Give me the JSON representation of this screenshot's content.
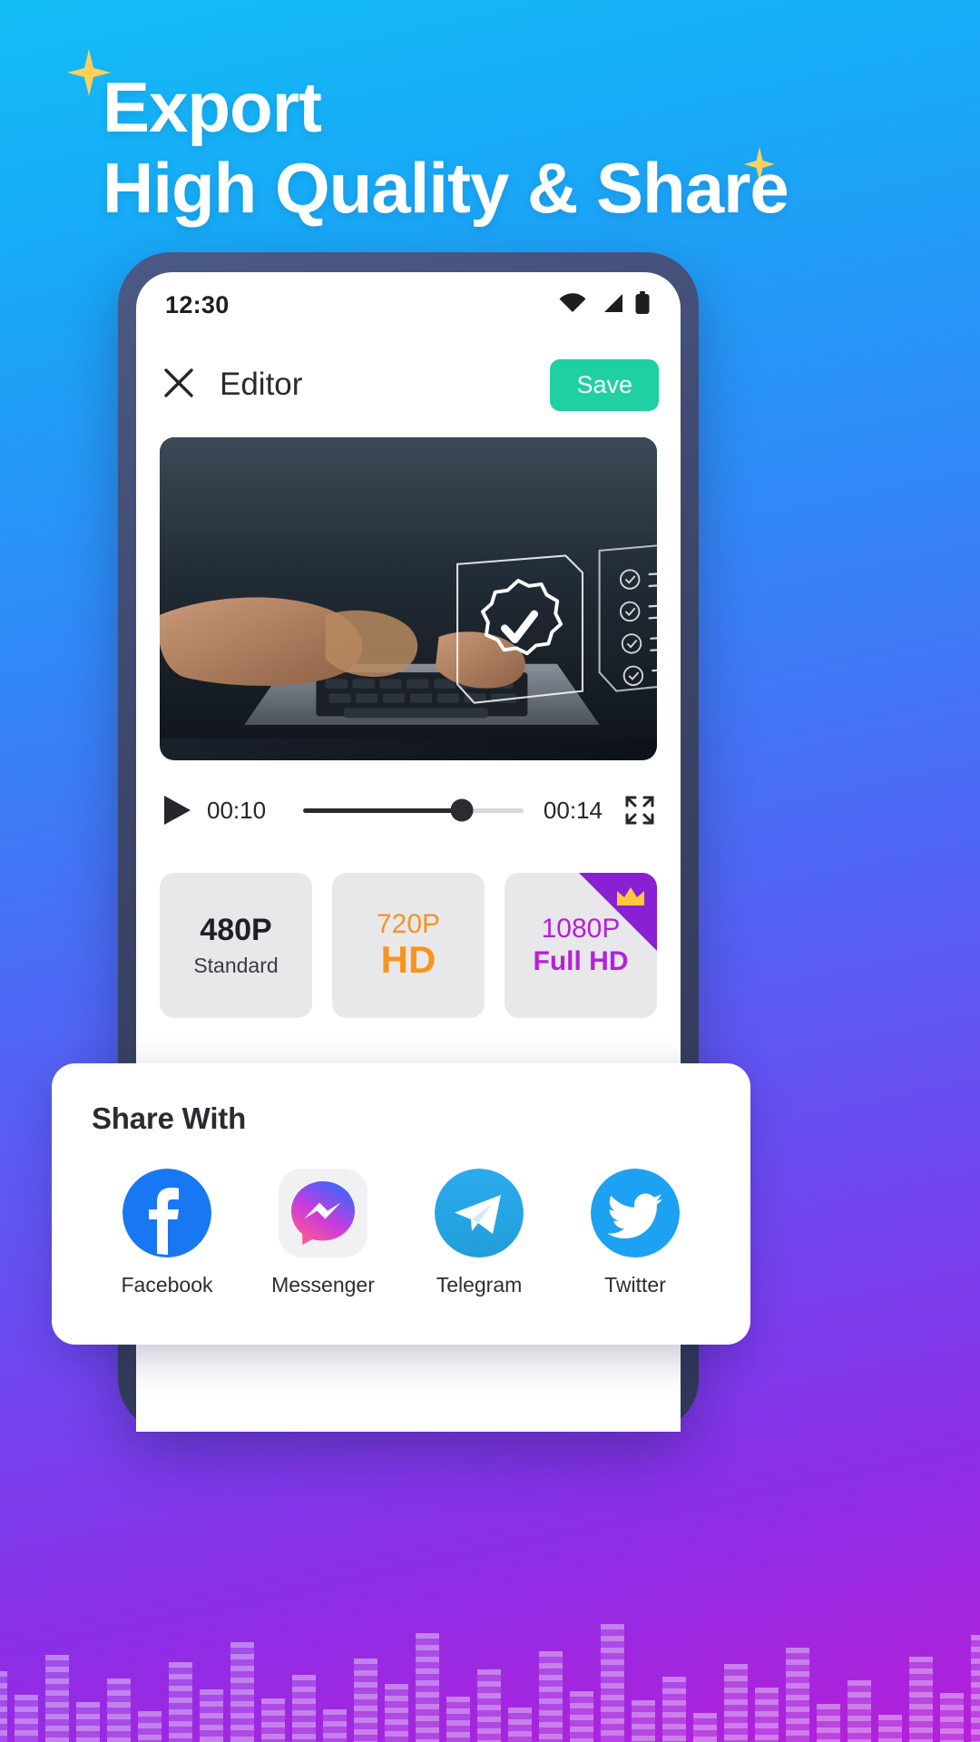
{
  "promo": {
    "headline_line1": "Export",
    "headline_line2": "High Quality & Share",
    "background_gradient": [
      "#13bdf7",
      "#4a6cf5",
      "#b51fd8"
    ],
    "sparkle_color": "#ffd257"
  },
  "phone": {
    "status_bar": {
      "time": "12:30",
      "icons": [
        "wifi-icon",
        "cellular-signal-icon",
        "battery-icon"
      ]
    },
    "editor_header": {
      "close_icon": "close-icon",
      "title": "Editor",
      "save_label": "Save",
      "save_color": "#1fd0a3"
    },
    "player": {
      "play_icon": "play-icon",
      "current_time": "00:10",
      "total_time": "00:14",
      "progress_percent": 72,
      "fullscreen_icon": "fullscreen-icon"
    },
    "resolutions": [
      {
        "name": "480P",
        "sub": "Standard",
        "premium": false,
        "color": "#1f1f25"
      },
      {
        "name": "720P",
        "sub": "HD",
        "premium": false,
        "color": "#f7941e"
      },
      {
        "name": "1080P",
        "sub": "Full HD",
        "premium": true,
        "color": "#b421d8",
        "badge_icon": "crown-icon"
      }
    ]
  },
  "share_sheet": {
    "title": "Share With",
    "items": [
      {
        "label": "Facebook",
        "icon": "facebook-icon",
        "color": "#1877f2"
      },
      {
        "label": "Messenger",
        "icon": "messenger-icon",
        "color": "#a033ff"
      },
      {
        "label": "Telegram",
        "icon": "telegram-icon",
        "color": "#229ed9"
      },
      {
        "label": "Twitter",
        "icon": "twitter-icon",
        "color": "#1da1f2"
      }
    ]
  }
}
